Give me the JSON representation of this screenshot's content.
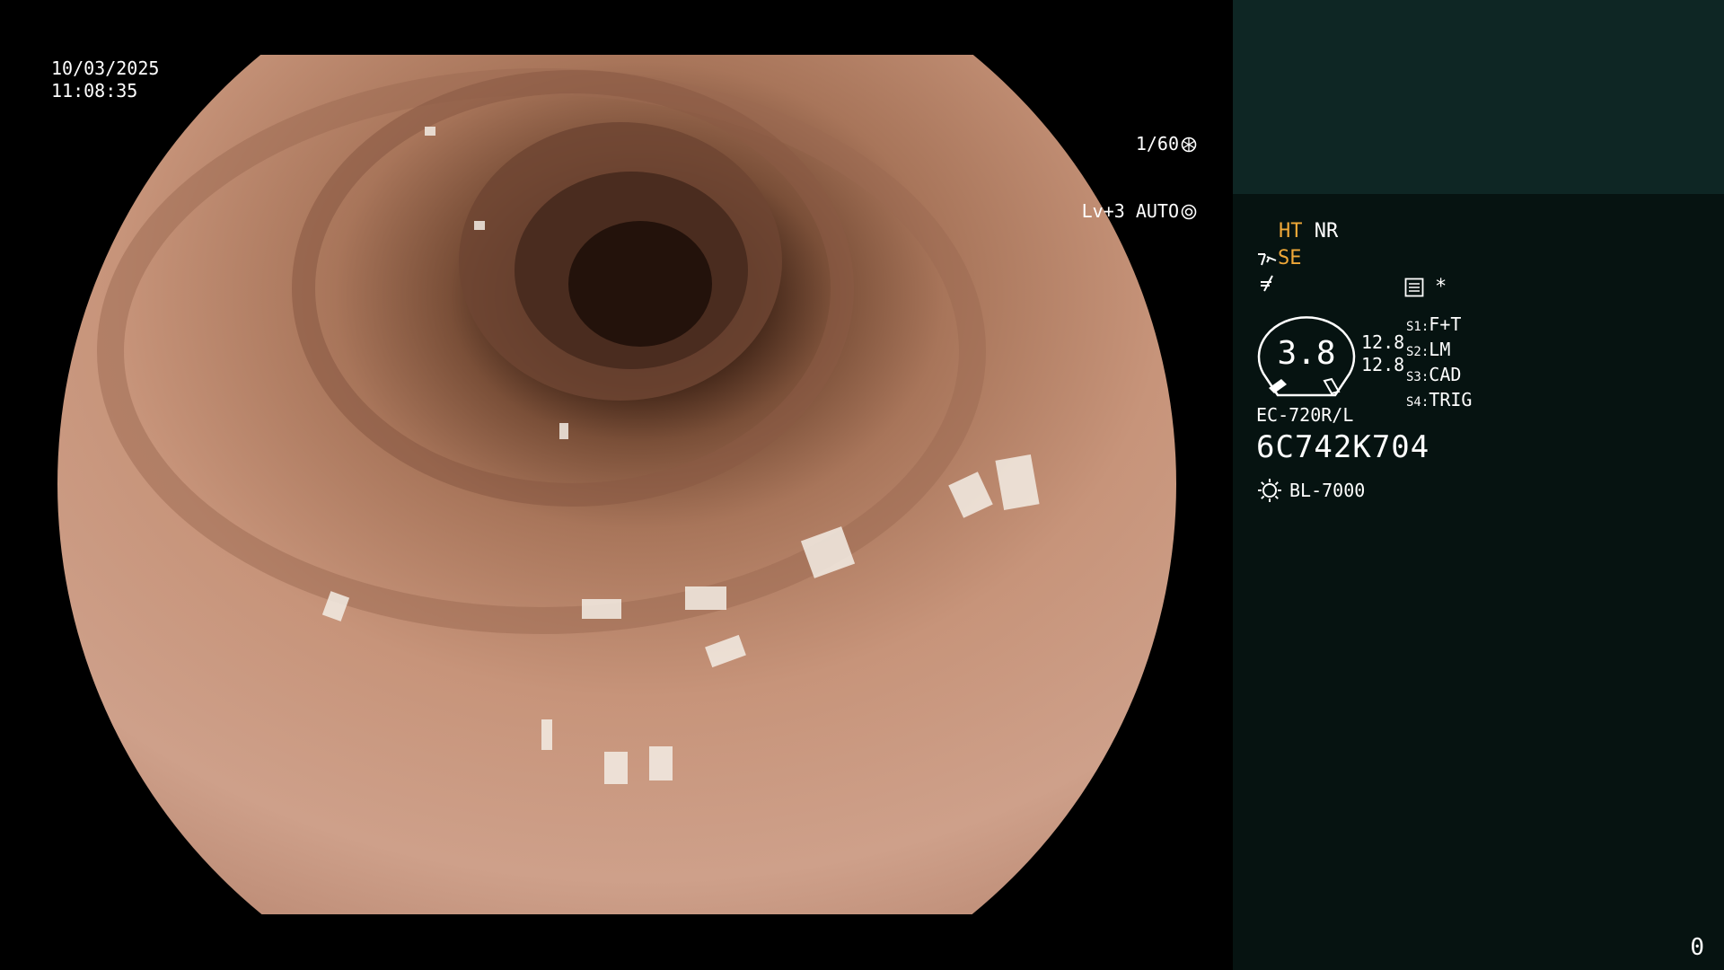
{
  "image": {
    "date": "10/03/2025",
    "time": "11:08:35",
    "shutter": "1/60",
    "iris": "Lv+3 AUTO",
    "shutter_icon": "aperture-icon",
    "iris_icon": "iris-icon"
  },
  "panel": {
    "ht": "HT",
    "nr": "NR",
    "se": "SE",
    "enhance_icon": "structure-enhance-icon",
    "color_icon": "color-mode-icon",
    "memo_icon": "memo-icon",
    "asterisk": "*",
    "zoom_value": "3.8",
    "ratio_top": "12.8",
    "ratio_bottom": "12.8",
    "switches": [
      {
        "key": "S1:",
        "value": "F+T"
      },
      {
        "key": "S2:",
        "value": "LM"
      },
      {
        "key": "S3:",
        "value": "CAD"
      },
      {
        "key": "S4:",
        "value": "TRIG"
      }
    ],
    "scope_model": "EC-720R/L",
    "serial": "6C742K704",
    "light_icon": "light-source-icon",
    "light_source": "BL-7000",
    "counter": "0"
  },
  "colors": {
    "panel_top": "#0e2624",
    "panel_bottom": "#061311",
    "amber": "#f0a838",
    "tissue": "#c89070"
  }
}
